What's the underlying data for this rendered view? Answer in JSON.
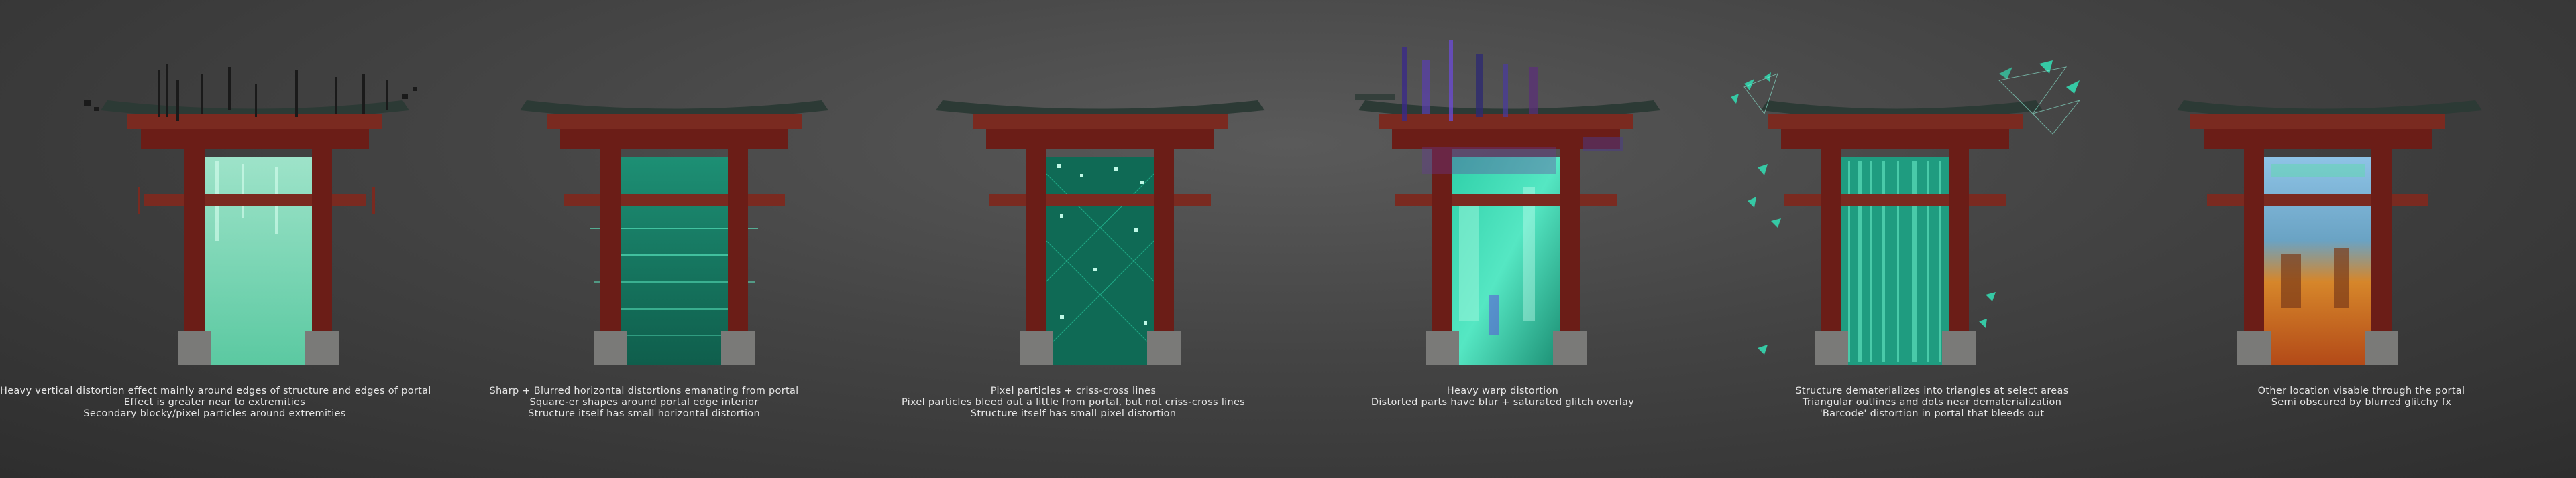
{
  "panels": [
    {
      "id": "vertical-distortion",
      "accent": "#7fe8c0",
      "caption": [
        "Heavy vertical distortion effect mainly around edges of structure and edges of portal",
        "Effect is greater near to extremities",
        "Secondary blocky/pixel particles around extremities"
      ]
    },
    {
      "id": "horizontal-distortion",
      "accent": "#2bc9a0",
      "caption": [
        "Sharp + Blurred horizontal distortions emanating from portal",
        "Square-er shapes around portal edge interior",
        "Structure itself has small horizontal distortion"
      ]
    },
    {
      "id": "pixel-particles",
      "accent": "#1fb08e",
      "caption": [
        "Pixel particles + criss-cross lines",
        "Pixel particles bleed out a little from portal, but not criss-cross lines",
        "Structure itself has small pixel distortion"
      ]
    },
    {
      "id": "warp-distortion",
      "accent": "#3fd9b4",
      "caption": [
        "Heavy warp distortion",
        "Distorted parts have blur + saturated glitch overlay"
      ]
    },
    {
      "id": "triangle-dematerialize",
      "accent": "#36c9a5",
      "caption": [
        "Structure dematerializes into triangles at select areas",
        "Triangular outlines and dots near dematerialization",
        "'Barcode' distortion in portal that bleeds out"
      ]
    },
    {
      "id": "other-location",
      "accent": "#e08a2a",
      "caption": [
        "Other location visable through the portal",
        "Semi obscured by blurred glitchy fx"
      ]
    }
  ],
  "colors": {
    "pillar": "#6b1d17",
    "beam": "#7a2a20",
    "roof": "#2c3a35",
    "base": "#7a7a78"
  }
}
